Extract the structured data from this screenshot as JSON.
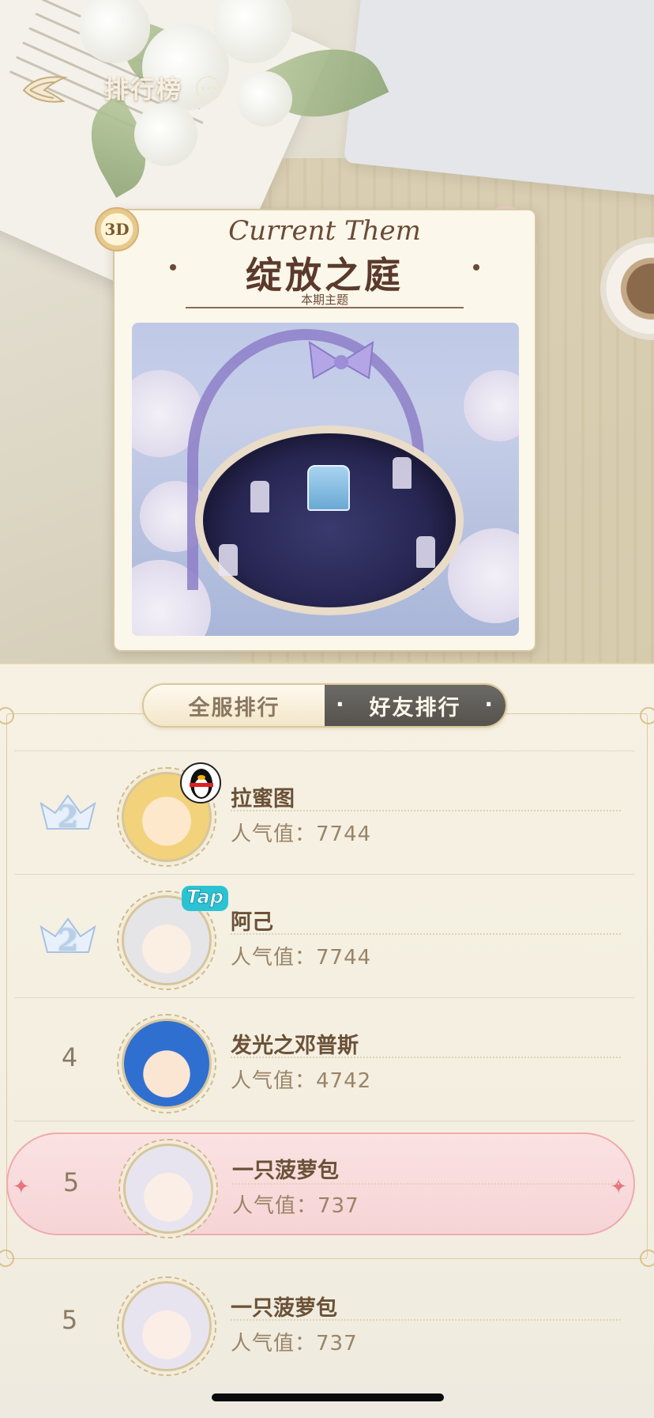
{
  "header": {
    "title": "排行榜",
    "back_icon": "wing-back-icon",
    "more_icon": "more-dots-icon"
  },
  "theme": {
    "badge": "3D",
    "title_en": "Current Them",
    "title_cn": "绽放之庭",
    "subtitle": "本期主题"
  },
  "tabs": {
    "global": "全服排行",
    "friends": "好友排行",
    "active": "friends"
  },
  "ranking": [
    {
      "rank": "2",
      "crown": true,
      "name": "拉蜜图",
      "score_label": "人气值：",
      "score": "7744",
      "badge": "qq"
    },
    {
      "rank": "2",
      "crown": true,
      "name": "阿己",
      "score_label": "人气值：",
      "score": "7744",
      "badge": "tap",
      "badge_text": "Tap"
    },
    {
      "rank": "4",
      "crown": false,
      "name": "发光之邓普斯",
      "score_label": "人气值：",
      "score": "4742"
    },
    {
      "rank": "5",
      "crown": false,
      "name": "一只菠萝包",
      "score_label": "人气值：",
      "score": "737",
      "highlight": true
    },
    {
      "rank": "5",
      "crown": false,
      "name": "一只菠萝包",
      "score_label": "人气值：",
      "score": "737"
    }
  ],
  "colors": {
    "accent_pink": "#f0a9ad",
    "tab_active": "#55524d",
    "gold_border": "#dcc595"
  }
}
